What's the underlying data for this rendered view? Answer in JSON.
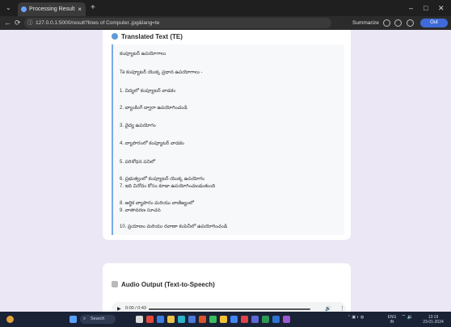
{
  "browser": {
    "tab_title": "Processing Result",
    "tab_close": "×",
    "new_tab": "+",
    "tab_menu": "⌄",
    "url": "127.0.0.1:5000/result?lines of Computer..jpg&lang=te",
    "summarize_label": "Summarize",
    "minimize": "–",
    "maximize": "□",
    "close": "✕",
    "profile_label": "Out"
  },
  "translated": {
    "title": "Translated Text (TE)",
    "lines": [
      "కంప్యూటర్ ఉపయోగాలు",
      "Ta కంప్యూటర్ యొక్క ప్రధాన ఉపయోగాలు -",
      "1. విద్యలో కంప్యూటర్ వాడకం",
      "2. బ్యాంకింగ్ ద్వారా ఉపయోగించండి",
      "3. వైద్య ఉపయోగం",
      "4. వ్యాపారంలో కంప్యూటర్ వాడకం",
      "5. పరిశోధన పనిలో",
      "6. ప్రభుత్వంలో కంప్యూటర్ యొక్క ఉపయోగం",
      "7. ఇది వినోదం కోసం కూడా ఉపయోగించబడుతుంది",
      "8. ఆర్థిక వ్యాపారం మరియు వాణిజ్యంలో",
      "9. వాతావరణ సూచన",
      "10. ప్రయాణం మరియు రవాణా కంపెనీలో ఉపయోగించండి"
    ]
  },
  "audio": {
    "title": "Audio Output (Text-to-Speech)",
    "time": "0:00 / 0:43",
    "play": "▶",
    "volume": "🔊",
    "more": "⋮"
  },
  "taskbar": {
    "search_label": "Search",
    "lang": "ENG",
    "lang_sub": "IN",
    "clock_time": "13:19",
    "clock_date": "23-01-2024"
  }
}
